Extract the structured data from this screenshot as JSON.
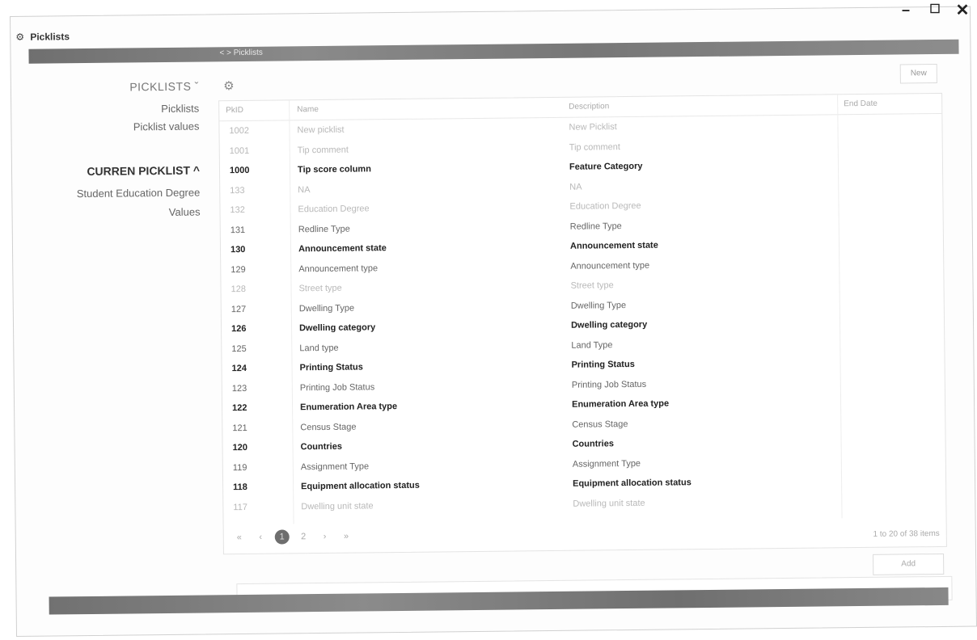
{
  "window": {
    "title": "Picklists",
    "app_icon": "picklist-app-icon",
    "controls": {
      "minimize": "–",
      "maximize": "☐",
      "close": "✕"
    }
  },
  "topbar": {
    "breadcrumb": "< > Picklists"
  },
  "sidebar": {
    "section1_heading": "PICKLISTS ˇ",
    "item_picklists": "Picklists",
    "item_picklist_values": "Picklist values",
    "section2_heading": "CURREN PICKLIST ^",
    "item_current": "Student Education Degree",
    "item_values": "Values"
  },
  "toolbar": {
    "new_label": "New",
    "settings_icon": "gear-icon"
  },
  "table": {
    "columns": {
      "id": "PkID",
      "name": "Name",
      "description": "Description",
      "end_date": "End Date"
    },
    "rows": [
      {
        "id": "1002",
        "name": "New picklist",
        "description": "New Picklist",
        "tone": "faint"
      },
      {
        "id": "1001",
        "name": "Tip comment",
        "description": "Tip comment",
        "tone": "faint"
      },
      {
        "id": "1000",
        "name": "Tip score column",
        "description": "Feature Category",
        "tone": "dark"
      },
      {
        "id": "133",
        "name": "NA",
        "description": "NA",
        "tone": "faint"
      },
      {
        "id": "132",
        "name": "Education Degree",
        "description": "Education Degree",
        "tone": "faint"
      },
      {
        "id": "131",
        "name": "Redline Type",
        "description": "Redline Type",
        "tone": "mid"
      },
      {
        "id": "130",
        "name": "Announcement state",
        "description": "Announcement state",
        "tone": "dark"
      },
      {
        "id": "129",
        "name": "Announcement type",
        "description": "Announcement type",
        "tone": "mid"
      },
      {
        "id": "128",
        "name": "Street type",
        "description": "Street type",
        "tone": "faint"
      },
      {
        "id": "127",
        "name": "Dwelling Type",
        "description": "Dwelling Type",
        "tone": "mid"
      },
      {
        "id": "126",
        "name": "Dwelling category",
        "description": "Dwelling category",
        "tone": "dark"
      },
      {
        "id": "125",
        "name": "Land type",
        "description": "Land Type",
        "tone": "mid"
      },
      {
        "id": "124",
        "name": "Printing Status",
        "description": "Printing Status",
        "tone": "dark"
      },
      {
        "id": "123",
        "name": "Printing Job Status",
        "description": "Printing Job Status",
        "tone": "mid"
      },
      {
        "id": "122",
        "name": "Enumeration Area type",
        "description": "Enumeration Area type",
        "tone": "dark"
      },
      {
        "id": "121",
        "name": "Census Stage",
        "description": "Census Stage",
        "tone": "mid"
      },
      {
        "id": "120",
        "name": "Countries",
        "description": "Countries",
        "tone": "dark"
      },
      {
        "id": "119",
        "name": "Assignment Type",
        "description": "Assignment Type",
        "tone": "mid"
      },
      {
        "id": "118",
        "name": "Equipment allocation status",
        "description": "Equipment allocation status",
        "tone": "dark"
      },
      {
        "id": "117",
        "name": "Dwelling unit state",
        "description": "Dwelling unit state",
        "tone": "faint"
      }
    ],
    "pager": {
      "first": "«",
      "prev": "‹",
      "current": "1",
      "page2": "2",
      "next": "›",
      "last": "»"
    },
    "count_text": "1 to 20 of 38 items"
  },
  "actions": {
    "add_label": "Add"
  },
  "footer": {
    "dots": "•••"
  }
}
